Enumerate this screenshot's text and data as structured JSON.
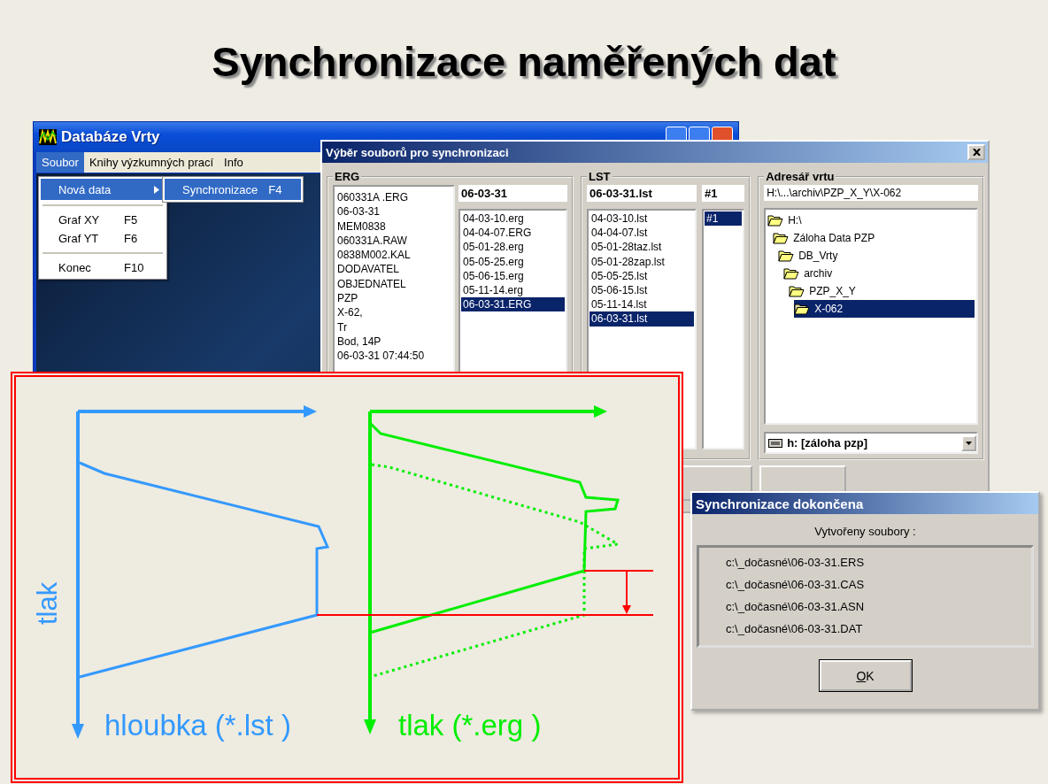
{
  "slide_title": "Synchronizace naměřených dat",
  "main_window": {
    "title": "Databáze Vrty",
    "menu": [
      {
        "label": "Soubor",
        "selected": true
      },
      {
        "label": "Knihy výzkumných prací",
        "selected": false
      },
      {
        "label": "Info",
        "selected": false
      }
    ],
    "dropdown": [
      {
        "kind": "item",
        "label": "Nová data",
        "has_submenu": true,
        "selected": true
      },
      {
        "kind": "separator"
      },
      {
        "kind": "item",
        "label": "Graf XY",
        "shortcut": "F5",
        "has_submenu": false,
        "selected": false
      },
      {
        "kind": "item",
        "label": "Graf YT",
        "shortcut": "F6",
        "has_submenu": false,
        "selected": false
      },
      {
        "kind": "separator"
      },
      {
        "kind": "item",
        "label": "Konec",
        "shortcut": "F10",
        "has_submenu": false,
        "selected": false
      }
    ],
    "submenu": [
      {
        "label": "Synchronizace",
        "shortcut": "F4",
        "selected": true
      }
    ]
  },
  "sync_dialog": {
    "title": "Výběr souborů pro synchronizaci",
    "erg": {
      "label": "ERG",
      "info_lines": [
        "060331A .ERG",
        "06-03-31",
        "MEM0838",
        "060331A.RAW",
        "0838M002.KAL",
        "DODAVATEL",
        "OBJEDNATEL",
        "PZP",
        "X-62,",
        "Tr",
        "Bod, 14P",
        "06-03-31 07:44:50"
      ],
      "field": "06-03-31",
      "files": [
        {
          "name": "04-03-10.erg",
          "selected": false
        },
        {
          "name": "04-04-07.ERG",
          "selected": false
        },
        {
          "name": "05-01-28.erg",
          "selected": false
        },
        {
          "name": "05-05-25.erg",
          "selected": false
        },
        {
          "name": "05-06-15.erg",
          "selected": false
        },
        {
          "name": "05-11-14.erg",
          "selected": false
        },
        {
          "name": "06-03-31.ERG",
          "selected": true
        }
      ]
    },
    "lst": {
      "label": "LST",
      "field": "06-03-31.lst",
      "channel_field": "#1",
      "files": [
        {
          "name": "04-03-10.lst",
          "selected": false
        },
        {
          "name": "04-04-07.lst",
          "selected": false
        },
        {
          "name": "05-01-28taz.lst",
          "selected": false
        },
        {
          "name": "05-01-28zap.lst",
          "selected": false
        },
        {
          "name": "05-05-25.lst",
          "selected": false
        },
        {
          "name": "05-06-15.lst",
          "selected": false
        },
        {
          "name": "05-11-14.lst",
          "selected": false
        },
        {
          "name": "06-03-31.lst",
          "selected": true
        }
      ],
      "channels": [
        {
          "name": "#1",
          "selected": true
        }
      ]
    },
    "directory": {
      "label": "Adresář vrtu",
      "path": "H:\\...\\archiv\\PZP_X_Y\\X-062",
      "tree": [
        {
          "name": "H:\\",
          "selected": false,
          "children": [
            {
              "name": "Záloha Data PZP",
              "selected": false,
              "children": [
                {
                  "name": "DB_Vrty",
                  "selected": false,
                  "children": [
                    {
                      "name": "archiv",
                      "selected": false,
                      "children": [
                        {
                          "name": "PZP_X_Y",
                          "selected": false,
                          "children": [
                            {
                              "name": "X-062",
                              "selected": true
                            }
                          ]
                        }
                      ]
                    }
                  ]
                }
              ]
            }
          ]
        }
      ],
      "drive": "h: [záloha pzp]"
    }
  },
  "diagram": {
    "vertical_label": "tlak",
    "depth_label": "hloubka (*.lst )",
    "pressure_label": "tlak (*.erg )"
  },
  "done_dialog": {
    "title": "Synchronizace dokončena",
    "message": "Vytvořeny soubory :",
    "files": [
      "c:\\_dočasné\\06-03-31.ERS",
      "c:\\_dočasné\\06-03-31.CAS",
      "c:\\_dočasné\\06-03-31.ASN",
      "c:\\_dočasné\\06-03-31.DAT"
    ],
    "button": "OK"
  }
}
